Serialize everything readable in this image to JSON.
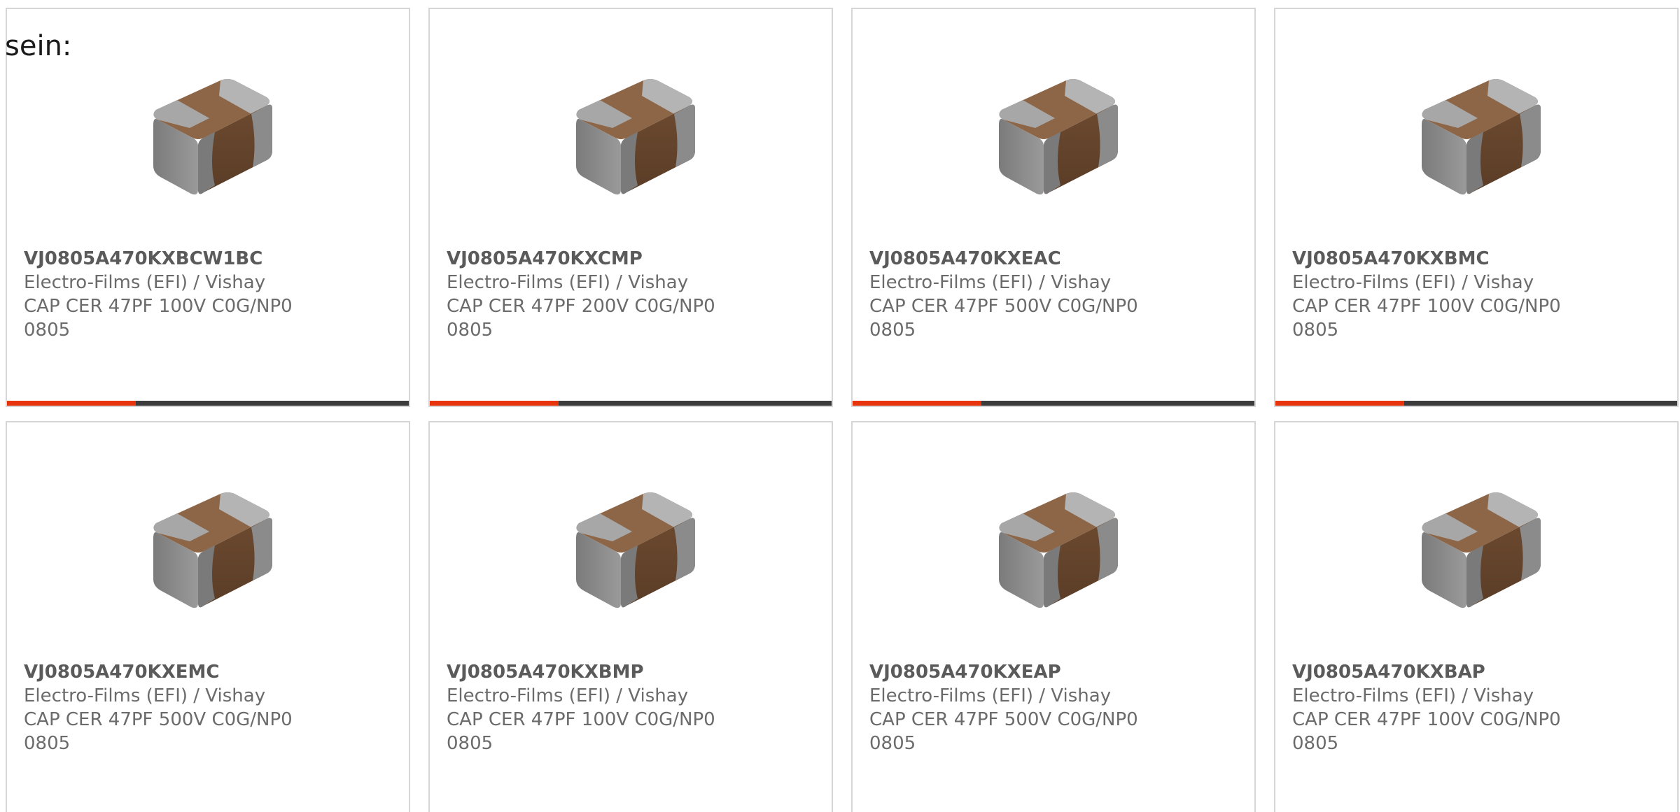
{
  "intro": {
    "text": "sein:"
  },
  "colors": {
    "accent": "#e8340c",
    "track": "#3c3c3c",
    "border": "#d6d6d6"
  },
  "products": [
    {
      "part_number": "VJ0805A470KXBCW1BC",
      "manufacturer": "Electro-Films (EFI) / Vishay",
      "description": "CAP CER 47PF 100V C0G/NP0",
      "package": "0805",
      "image_icon": "ceramic-capacitor-chip-icon",
      "progress": 0.32
    },
    {
      "part_number": "VJ0805A470KXCMP",
      "manufacturer": "Electro-Films (EFI) / Vishay",
      "description": "CAP CER 47PF 200V C0G/NP0",
      "package": "0805",
      "image_icon": "ceramic-capacitor-chip-icon",
      "progress": 0.32
    },
    {
      "part_number": "VJ0805A470KXEAC",
      "manufacturer": "Electro-Films (EFI) / Vishay",
      "description": "CAP CER 47PF 500V C0G/NP0",
      "package": "0805",
      "image_icon": "ceramic-capacitor-chip-icon",
      "progress": 0.32
    },
    {
      "part_number": "VJ0805A470KXBMC",
      "manufacturer": "Electro-Films (EFI) / Vishay",
      "description": "CAP CER 47PF 100V C0G/NP0",
      "package": "0805",
      "image_icon": "ceramic-capacitor-chip-icon",
      "progress": 0.32
    },
    {
      "part_number": "VJ0805A470KXEMC",
      "manufacturer": "Electro-Films (EFI) / Vishay",
      "description": "CAP CER 47PF 500V C0G/NP0",
      "package": "0805",
      "image_icon": "ceramic-capacitor-chip-icon",
      "progress": null
    },
    {
      "part_number": "VJ0805A470KXBMP",
      "manufacturer": "Electro-Films (EFI) / Vishay",
      "description": "CAP CER 47PF 100V C0G/NP0",
      "package": "0805",
      "image_icon": "ceramic-capacitor-chip-icon",
      "progress": null
    },
    {
      "part_number": "VJ0805A470KXEAP",
      "manufacturer": "Electro-Films (EFI) / Vishay",
      "description": "CAP CER 47PF 500V C0G/NP0",
      "package": "0805",
      "image_icon": "ceramic-capacitor-chip-icon",
      "progress": null
    },
    {
      "part_number": "VJ0805A470KXBAP",
      "manufacturer": "Electro-Films (EFI) / Vishay",
      "description": "CAP CER 47PF 100V C0G/NP0",
      "package": "0805",
      "image_icon": "ceramic-capacitor-chip-icon",
      "progress": null
    }
  ]
}
